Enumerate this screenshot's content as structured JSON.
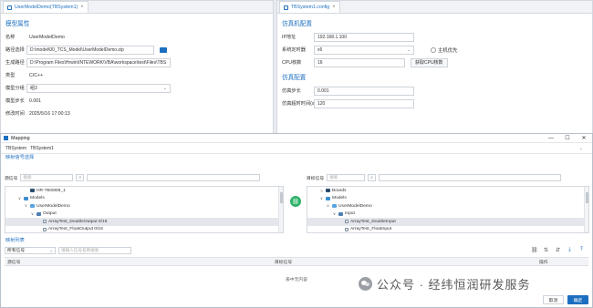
{
  "left_pane": {
    "tab_label": "UserModelDemo(TBSystem1)",
    "section_title": "模型属性",
    "rows": [
      {
        "label": "名称",
        "value": "UserModelDemo"
      },
      {
        "label": "路径选择",
        "value": "D:\\model\\00_TCS_Model\\UserModelDemo.zip"
      },
      {
        "label": "生成路径",
        "value": "D:\\Program Files\\Hrwin\\INTEWORK\\VBA\\workspace\\test\\Files\\TBS"
      },
      {
        "label": "类型",
        "value": "C/C++"
      },
      {
        "label": "模型分组",
        "value": "组3"
      },
      {
        "label": "模型步长",
        "value": "0.001"
      },
      {
        "label": "修改时间",
        "value": "2025/5/16 17:00:13"
      }
    ]
  },
  "right_pane": {
    "tab_label": "TBSystem1.config",
    "section1_title": "仿真机配置",
    "ip_label": "IP地址",
    "ip_value": "192.168.1.100",
    "clock_label": "系统定时器",
    "clock_value": "x6",
    "prefer_label": "主机优先",
    "cpu_label": "CPU核数",
    "cpu_value": "16",
    "cpu_button": "获取CPU核数",
    "section2_title": "仿真配置",
    "step_label": "仿真步长",
    "step_value": "0.001",
    "timeout_label": "仿真超时时间(s)",
    "timeout_value": "120"
  },
  "dialog": {
    "title": "Mapping",
    "minimize": "—",
    "maximize": "☐",
    "close": "✕",
    "system_label": "TBSystem",
    "system_value": "TBSystem1",
    "select_section": "映射信号选择",
    "source_label": "源信号",
    "source_placeholder": "搜索",
    "target_label": "目标信号",
    "target_placeholder": "搜索",
    "left_tree": [
      {
        "label": "HR-TBS908_1",
        "icon": "board",
        "indent": 2,
        "twisty": "",
        "selected": false
      },
      {
        "label": "Models",
        "icon": "models",
        "indent": 1,
        "twisty": "∨",
        "selected": false
      },
      {
        "label": "UserModelDemo",
        "icon": "model",
        "indent": 2,
        "twisty": "∨",
        "selected": false
      },
      {
        "label": "Output",
        "icon": "port",
        "indent": 3,
        "twisty": "∨",
        "selected": false
      },
      {
        "label": "ArrayTest_DoubleOutput 0/16",
        "icon": "var",
        "indent": 4,
        "twisty": "",
        "selected": true
      },
      {
        "label": "ArrayTest_FloatOutput 0/16",
        "icon": "var",
        "indent": 4,
        "twisty": "",
        "selected": false
      }
    ],
    "right_tree": [
      {
        "label": "Boards",
        "icon": "board",
        "indent": 1,
        "twisty": ">",
        "selected": false
      },
      {
        "label": "Models",
        "icon": "models",
        "indent": 1,
        "twisty": "∨",
        "selected": false
      },
      {
        "label": "UserModelDemo",
        "icon": "model",
        "indent": 2,
        "twisty": "∨",
        "selected": false
      },
      {
        "label": "Input",
        "icon": "port",
        "indent": 3,
        "twisty": "∨",
        "selected": false
      },
      {
        "label": "ArrayTest_DoubleInput",
        "icon": "var",
        "indent": 4,
        "twisty": "",
        "selected": true
      },
      {
        "label": "ArrayTest_FloatInput",
        "icon": "var",
        "indent": 4,
        "twisty": "",
        "selected": false
      }
    ],
    "list_section": "映射列表",
    "filter_value": "所有信号",
    "filter_placeholder": "请输入信号名称搜索",
    "col_source": "源信号",
    "col_target": "目标信号",
    "col_action": "操作",
    "empty_text": "表中无内容",
    "cancel_label": "取消",
    "ok_label": "确定"
  },
  "watermark_text": "公众号 · 经纬恒润研发服务",
  "colors": {
    "accent": "#1c6fc0",
    "map_button": "#2fb36a"
  }
}
